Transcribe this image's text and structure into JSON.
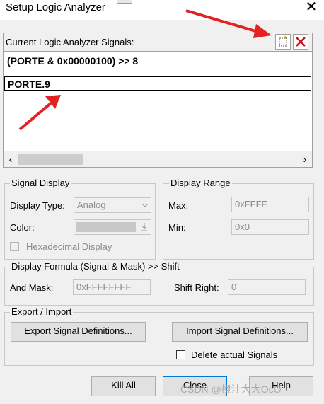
{
  "window": {
    "title": "Setup Logic Analyzer"
  },
  "signals": {
    "label": "Current Logic Analyzer Signals:",
    "items": [
      "(PORTE & 0x00000100) >> 8",
      "PORTE.9"
    ]
  },
  "signal_display": {
    "title": "Signal Display",
    "display_type_label": "Display Type:",
    "display_type_value": "Analog",
    "color_label": "Color:",
    "hex_label": "Hexadecimal Display"
  },
  "display_range": {
    "title": "Display Range",
    "max_label": "Max:",
    "max_value": "0xFFFF",
    "min_label": "Min:",
    "min_value": "0x0"
  },
  "formula": {
    "title": "Display Formula (Signal & Mask) >> Shift",
    "and_mask_label": "And Mask:",
    "and_mask_value": "0xFFFFFFFF",
    "shift_right_label": "Shift Right:",
    "shift_right_value": "0"
  },
  "export_import": {
    "title": "Export / Import",
    "export_label": "Export Signal Definitions...",
    "import_label": "Import Signal Definitions...",
    "delete_label": "Delete actual Signals"
  },
  "buttons": {
    "kill_all": "Kill All",
    "close": "Close",
    "help": "Help"
  },
  "watermark": "CSDN @橙汁大大OcO",
  "colors": {
    "annotation_arrow": "#e32222"
  }
}
